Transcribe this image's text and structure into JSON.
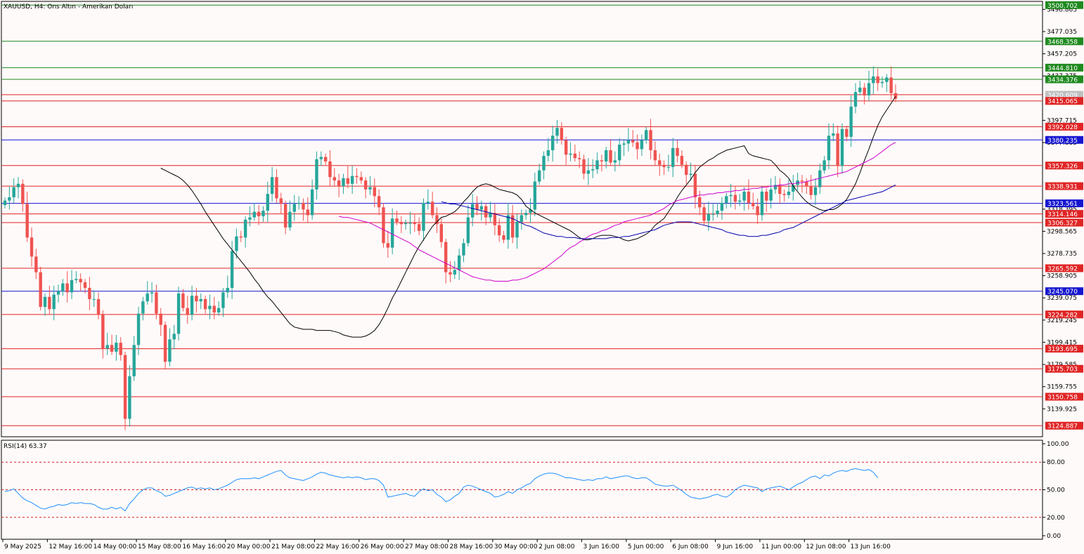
{
  "chart_data": {
    "type": "candlestick",
    "title": "XAUUSD, H4:  Ons Altın - Amerikan Doları",
    "symbol": "XAUUSD",
    "timeframe": "H4",
    "ylim": [
      3115,
      3504
    ],
    "y_ticks": [
      "3496.865",
      "3477.035",
      "3457.205",
      "3437.375",
      "3397.715",
      "3377.885",
      "3318.395",
      "3298.565",
      "3278.735",
      "3258.905",
      "3239.075",
      "3219.245",
      "3199.415",
      "3179.585",
      "3159.755",
      "3139.925"
    ],
    "x_labels": [
      "9 May 2025",
      "12 May 16:00",
      "14 May 00:00",
      "15 May 08:00",
      "16 May 16:00",
      "20 May 00:00",
      "21 May 08:00",
      "22 May 16:00",
      "26 May 00:00",
      "27 May 08:00",
      "28 May 16:00",
      "30 May 00:00",
      "2 Jun 08:00",
      "3 Jun 16:00",
      "5 Jun 00:00",
      "6 Jun 08:00",
      "9 Jun 16:00",
      "11 Jun 00:00",
      "12 Jun 08:00",
      "13 Jun 16:00"
    ],
    "x_label_candle_index": [
      0,
      10,
      20,
      30,
      40,
      50,
      60,
      70,
      80,
      90,
      100,
      110,
      120,
      130,
      140,
      150,
      160,
      170,
      180,
      190
    ],
    "levels": [
      {
        "value": "3500.702",
        "color": "#1f8a1f",
        "fill": "#1f8a1f"
      },
      {
        "value": "3468.358",
        "color": "#1f8a1f",
        "fill": "#1f8a1f"
      },
      {
        "value": "3444.810",
        "color": "#1f8a1f",
        "fill": "#1f8a1f"
      },
      {
        "value": "3434.376",
        "color": "#1f8a1f",
        "fill": "#1f8a1f"
      },
      {
        "value": "3420.609",
        "color": "#e02424",
        "fill": "#c0c0c0"
      },
      {
        "value": "3415.065",
        "color": "#e02424",
        "fill": "#e02424"
      },
      {
        "value": "3392.028",
        "color": "#e02424",
        "fill": "#e02424"
      },
      {
        "value": "3380.235",
        "color": "#1515d0",
        "fill": "#1515d0"
      },
      {
        "value": "3357.326",
        "color": "#e02424",
        "fill": "#e02424"
      },
      {
        "value": "3338.931",
        "color": "#e02424",
        "fill": "#e02424"
      },
      {
        "value": "3323.561",
        "color": "#1515d0",
        "fill": "#1515d0"
      },
      {
        "value": "3314.146",
        "color": "#e02424",
        "fill": "#e02424"
      },
      {
        "value": "3306.327",
        "color": "#e02424",
        "fill": "#e02424"
      },
      {
        "value": "3265.592",
        "color": "#e02424",
        "fill": "#e02424"
      },
      {
        "value": "3245.070",
        "color": "#1515d0",
        "fill": "#1515d0"
      },
      {
        "value": "3224.282",
        "color": "#e02424",
        "fill": "#e02424"
      },
      {
        "value": "3193.695",
        "color": "#e02424",
        "fill": "#e02424"
      },
      {
        "value": "3175.703",
        "color": "#e02424",
        "fill": "#e02424"
      },
      {
        "value": "3150.758",
        "color": "#e02424",
        "fill": "#e02424"
      },
      {
        "value": "3124.887",
        "color": "#e02424",
        "fill": "#e02424"
      }
    ],
    "close": [
      3326,
      3329,
      3338,
      3341,
      3323,
      3293,
      3276,
      3262,
      3231,
      3240,
      3229,
      3242,
      3245,
      3252,
      3244,
      3255,
      3256,
      3253,
      3248,
      3238,
      3238,
      3224,
      3194,
      3197,
      3191,
      3199,
      3188,
      3131,
      3169,
      3197,
      3225,
      3236,
      3243,
      3244,
      3225,
      3215,
      3182,
      3202,
      3207,
      3243,
      3230,
      3224,
      3241,
      3236,
      3238,
      3229,
      3232,
      3226,
      3230,
      3244,
      3248,
      3281,
      3294,
      3293,
      3309,
      3311,
      3316,
      3312,
      3317,
      3332,
      3347,
      3328,
      3323,
      3302,
      3316,
      3323,
      3324,
      3318,
      3313,
      3336,
      3363,
      3365,
      3361,
      3347,
      3344,
      3339,
      3346,
      3341,
      3348,
      3347,
      3344,
      3336,
      3338,
      3330,
      3320,
      3288,
      3284,
      3310,
      3307,
      3305,
      3306,
      3306,
      3305,
      3299,
      3324,
      3325,
      3313,
      3305,
      3289,
      3262,
      3260,
      3264,
      3277,
      3288,
      3311,
      3323,
      3318,
      3321,
      3311,
      3315,
      3304,
      3295,
      3291,
      3313,
      3293,
      3307,
      3313,
      3315,
      3318,
      3343,
      3353,
      3366,
      3371,
      3384,
      3391,
      3380,
      3367,
      3368,
      3364,
      3363,
      3350,
      3353,
      3354,
      3362,
      3361,
      3371,
      3360,
      3362,
      3376,
      3377,
      3380,
      3378,
      3372,
      3380,
      3389,
      3371,
      3362,
      3358,
      3356,
      3356,
      3373,
      3366,
      3358,
      3349,
      3350,
      3329,
      3320,
      3308,
      3314,
      3314,
      3317,
      3324,
      3330,
      3331,
      3325,
      3326,
      3334,
      3324,
      3321,
      3313,
      3334,
      3326,
      3336,
      3340,
      3332,
      3331,
      3334,
      3340,
      3344,
      3343,
      3339,
      3331,
      3338,
      3353,
      3362,
      3384,
      3386,
      3357,
      3390,
      3383,
      3410,
      3423,
      3427,
      3420,
      3431,
      3437,
      3431,
      3432,
      3436,
      3422,
      3417
    ],
    "sma_short": [
      3355,
      3353,
      3351,
      3349,
      3347,
      3344,
      3340,
      3335,
      3329,
      3323,
      3316,
      3310,
      3304,
      3298,
      3292,
      3287,
      3282,
      3277,
      3272,
      3267,
      3262,
      3256,
      3251,
      3245,
      3240,
      3236,
      3231,
      3226,
      3221,
      3216,
      3213,
      3212,
      3211,
      3211,
      3211,
      3210,
      3210,
      3210,
      3210,
      3209,
      3208,
      3206,
      3205,
      3204,
      3204,
      3204,
      3205,
      3207,
      3210,
      3215,
      3222,
      3230,
      3239,
      3246,
      3254,
      3262,
      3270,
      3278,
      3285,
      3291,
      3297,
      3303,
      3307,
      3311,
      3312,
      3314,
      3316,
      3320,
      3325,
      3329,
      3334,
      3338,
      3340,
      3341,
      3340,
      3338,
      3336,
      3335,
      3334,
      3333,
      3331,
      3327,
      3321,
      3318,
      3315,
      3313,
      3311,
      3309,
      3307,
      3305,
      3303,
      3301,
      3299,
      3296,
      3293,
      3291,
      3291,
      3292,
      3294,
      3295,
      3295,
      3295,
      3294,
      3293,
      3291,
      3290,
      3291,
      3292,
      3294,
      3296,
      3299,
      3304,
      3307,
      3310,
      3316,
      3322,
      3329,
      3335,
      3340,
      3345,
      3351,
      3356,
      3359,
      3362,
      3364,
      3367,
      3369,
      3371,
      3372,
      3373,
      3374,
      3375,
      3368,
      3366,
      3365,
      3364,
      3363,
      3362,
      3358,
      3353,
      3350,
      3346,
      3339,
      3334,
      3329,
      3325,
      3322,
      3320,
      3318,
      3317,
      3318,
      3318,
      3320,
      3323,
      3327,
      3334,
      3341,
      3351,
      3362,
      3372,
      3383,
      3393,
      3401,
      3407,
      3413,
      3419
    ],
    "sma_mid": [
      3312,
      3311,
      3311,
      3310,
      3309,
      3308,
      3307,
      3306,
      3304,
      3302,
      3300,
      3298,
      3296,
      3294,
      3292,
      3290,
      3288,
      3285,
      3282,
      3280,
      3278,
      3276,
      3274,
      3272,
      3270,
      3268,
      3266,
      3264,
      3262,
      3260,
      3258,
      3257,
      3256,
      3255,
      3255,
      3254,
      3254,
      3254,
      3254,
      3255,
      3255,
      3256,
      3257,
      3259,
      3261,
      3263,
      3265,
      3268,
      3271,
      3274,
      3277,
      3281,
      3284,
      3286,
      3289,
      3291,
      3294,
      3296,
      3297,
      3299,
      3300,
      3302,
      3304,
      3305,
      3307,
      3308,
      3309,
      3310,
      3311,
      3312,
      3313,
      3315,
      3317,
      3319,
      3322,
      3324,
      3326,
      3327,
      3328,
      3329,
      3330,
      3331,
      3331,
      3332,
      3332,
      3333,
      3333,
      3334,
      3334,
      3335,
      3335,
      3336,
      3336,
      3337,
      3337,
      3338,
      3338,
      3339,
      3339,
      3340,
      3340,
      3341,
      3341,
      3342,
      3342,
      3343,
      3344,
      3345,
      3346,
      3347,
      3348,
      3349,
      3350,
      3351,
      3352,
      3354,
      3356,
      3358,
      3360,
      3362,
      3364,
      3367,
      3370,
      3373,
      3376,
      3378
    ],
    "sma_long": [
      3325,
      3324,
      3323,
      3323,
      3322,
      3321,
      3320,
      3319,
      3318,
      3317,
      3316,
      3315,
      3314,
      3313,
      3312,
      3311,
      3310,
      3308,
      3306,
      3304,
      3303,
      3301,
      3299,
      3297,
      3296,
      3295,
      3294,
      3294,
      3293,
      3293,
      3293,
      3292,
      3292,
      3292,
      3292,
      3292,
      3292,
      3292,
      3293,
      3293,
      3293,
      3294,
      3294,
      3295,
      3296,
      3297,
      3298,
      3299,
      3300,
      3302,
      3304,
      3305,
      3306,
      3307,
      3307,
      3307,
      3307,
      3306,
      3305,
      3304,
      3303,
      3302,
      3301,
      3300,
      3298,
      3297,
      3296,
      3295,
      3295,
      3294,
      3294,
      3294,
      3295,
      3295,
      3296,
      3297,
      3298,
      3300,
      3301,
      3302,
      3304,
      3306,
      3308,
      3310,
      3312,
      3314,
      3316,
      3318,
      3320,
      3322,
      3324,
      3326,
      3327,
      3328,
      3329,
      3330,
      3331,
      3332,
      3333,
      3334,
      3336,
      3338,
      3340
    ],
    "rsi": {
      "label": "RSI(14) 63.37",
      "ylim": [
        0,
        100
      ],
      "ticks": [
        "100.00",
        "80.00",
        "50.00",
        "20.00",
        "0.00"
      ],
      "levels": [
        80,
        50,
        20
      ],
      "values": [
        48,
        49,
        51,
        46,
        41,
        38,
        36,
        33,
        30,
        29,
        31,
        32,
        34,
        33,
        34,
        36,
        35,
        36,
        35,
        35,
        34,
        31,
        29,
        29,
        31,
        29,
        31,
        27,
        35,
        40,
        46,
        50,
        52,
        52,
        49,
        47,
        43,
        44,
        46,
        48,
        50,
        52,
        53,
        51,
        52,
        51,
        52,
        50,
        51,
        53,
        55,
        58,
        61,
        62,
        62,
        62,
        63,
        62,
        64,
        66,
        68,
        70,
        71,
        66,
        63,
        62,
        61,
        60,
        62,
        64,
        67,
        69,
        68,
        66,
        65,
        64,
        63,
        64,
        63,
        64,
        63,
        61,
        62,
        62,
        60,
        55,
        42,
        43,
        44,
        45,
        46,
        44,
        43,
        48,
        51,
        49,
        50,
        45,
        42,
        37,
        39,
        43,
        46,
        53,
        55,
        54,
        52,
        50,
        48,
        46,
        42,
        43,
        45,
        48,
        46,
        50,
        52,
        55,
        57,
        62,
        65,
        67,
        68,
        68,
        67,
        65,
        63,
        63,
        62,
        61,
        60,
        61,
        60,
        62,
        62,
        64,
        62,
        63,
        64,
        65,
        65,
        63,
        62,
        63,
        63,
        60,
        56,
        55,
        54,
        54,
        55,
        52,
        49,
        45,
        42,
        41,
        40,
        41,
        42,
        44,
        45,
        43,
        42,
        45,
        50,
        53,
        55,
        54,
        53,
        52,
        48,
        51,
        52,
        53,
        54,
        52,
        50,
        53,
        56,
        58,
        61,
        64,
        65,
        62,
        66,
        65,
        68,
        70,
        71,
        70,
        72,
        73,
        72,
        71,
        72,
        69,
        63
      ]
    },
    "colors": {
      "bull": "#26a69a",
      "bear": "#ef5350",
      "sma_short": "#000000",
      "sma_mid": "#cc00cc",
      "sma_long": "#0000aa",
      "rsi": "#1e90ff",
      "rsi_levels": "#cc2222",
      "grid": "#000000"
    }
  }
}
